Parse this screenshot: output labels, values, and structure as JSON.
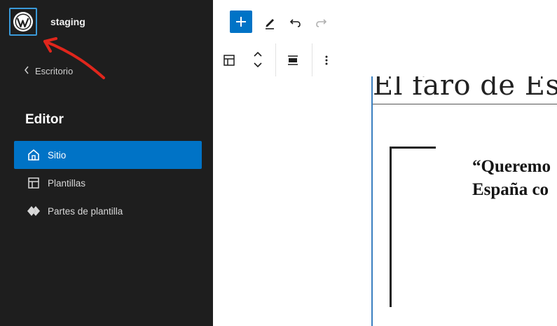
{
  "sidebar": {
    "site_name": "staging",
    "back_label": "Escritorio",
    "editor_title": "Editor",
    "items": [
      {
        "label": "Sitio",
        "icon": "home-icon",
        "active": true
      },
      {
        "label": "Plantillas",
        "icon": "layout-icon",
        "active": false
      },
      {
        "label": "Partes de plantilla",
        "icon": "symbol-filled-icon",
        "active": false
      }
    ]
  },
  "colors": {
    "sidebar_bg": "#1e1e1e",
    "accent": "#0073c6",
    "annotation_arrow": "#e0261c"
  },
  "canvas": {
    "title": "El faro de Es",
    "quote_line1": "“Queremo",
    "quote_line2": "España co"
  }
}
